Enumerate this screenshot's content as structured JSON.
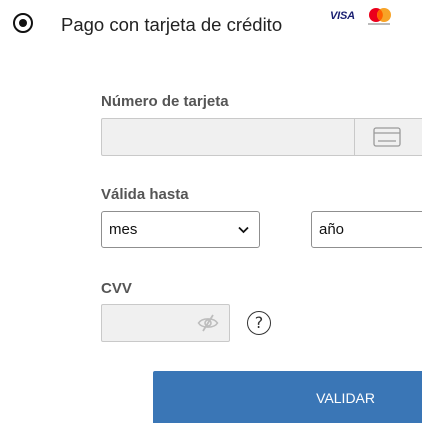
{
  "payment_method": {
    "label": "Pago con tarjeta de crédito",
    "selected": true,
    "brands": [
      "VISA",
      "mastercard-logo"
    ],
    "visa_text": "VISA"
  },
  "card_number": {
    "label": "Número de tarjeta",
    "value": "",
    "placeholder": "",
    "icon": "credit-card-icon"
  },
  "expiry": {
    "label": "Válida hasta",
    "month": {
      "value": "mes",
      "icon": "chevron-down-icon"
    },
    "year": {
      "value": "año"
    }
  },
  "cvv": {
    "label": "CVV",
    "value": "",
    "toggle_icon": "eye-slash-icon",
    "help_icon": "question-circle-icon",
    "help_glyph": "?"
  },
  "actions": {
    "validate_label": "VALIDAR"
  },
  "colors": {
    "accent": "#3a76b6",
    "label": "#555555",
    "input_bg": "#f0f0f0",
    "visa_blue": "#1a1f71",
    "mc_red": "#eb001b",
    "mc_orange": "#f79e1b"
  }
}
